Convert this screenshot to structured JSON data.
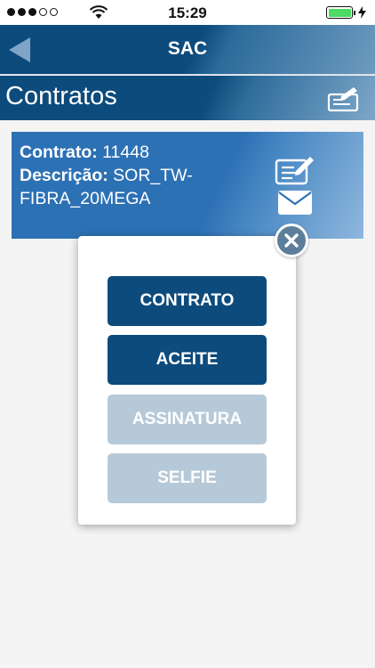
{
  "status_bar": {
    "time": "15:29",
    "signal_filled": 3,
    "signal_total": 5,
    "battery_level": 1.0
  },
  "header": {
    "title": "SAC",
    "back_icon": "back-arrow-icon"
  },
  "section": {
    "title": "Contratos",
    "icon": "signature-icon"
  },
  "contract": {
    "number_label": "Contrato:",
    "number_value": "11448",
    "description_label": "Descrição:",
    "description_line1": "SOR_TW-",
    "description_line2": "FIBRA_20MEGA",
    "edit_icon": "sign-document-icon",
    "mail_icon": "mail-icon"
  },
  "modal": {
    "close_icon": "close-icon",
    "buttons": [
      {
        "label": "CONTRATO",
        "enabled": true
      },
      {
        "label": "ACEITE",
        "enabled": true
      },
      {
        "label": "ASSINATURA",
        "enabled": false
      },
      {
        "label": "SELFIE",
        "enabled": false
      }
    ]
  },
  "colors": {
    "primary": "#0d4b7c",
    "card": "#2d71b5",
    "disabled": "#b6c9d8",
    "battery": "#4cd964"
  }
}
